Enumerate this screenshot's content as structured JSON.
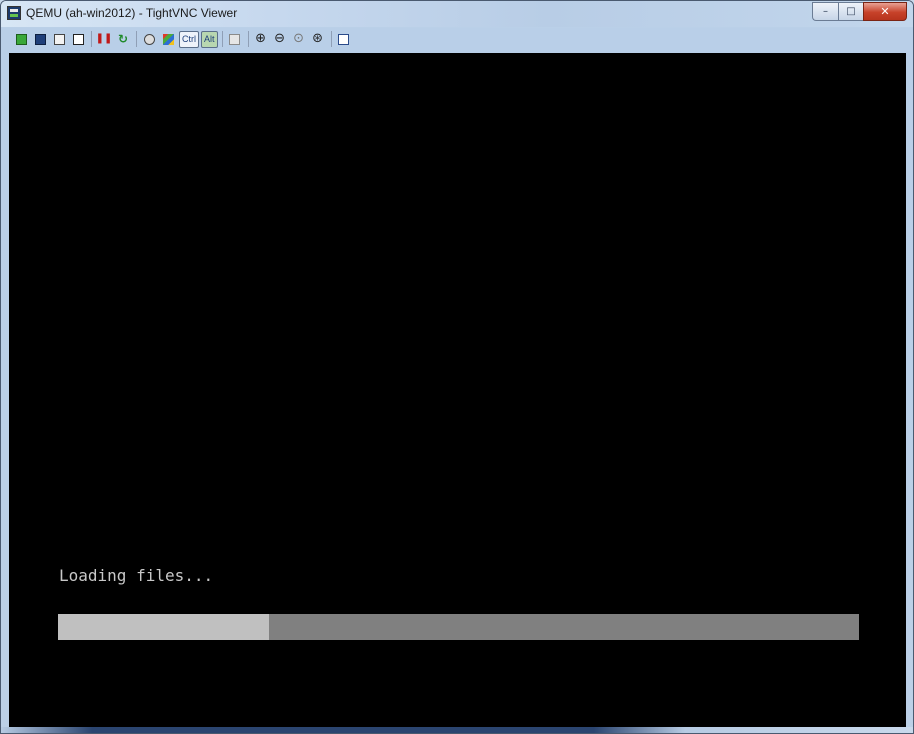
{
  "window": {
    "title": "QEMU (ah-win2012) - TightVNC Viewer",
    "controls": {
      "minimize": "–",
      "maximize": "□",
      "close": "✕"
    }
  },
  "toolbar": {
    "items": [
      {
        "name": "new-connection-icon",
        "glyph": ""
      },
      {
        "name": "save-icon",
        "glyph": ""
      },
      {
        "name": "options-icon",
        "glyph": ""
      },
      {
        "name": "connection-info-icon",
        "glyph": ""
      },
      {
        "name": "pause-icon",
        "glyph": "❚❚"
      },
      {
        "name": "refresh-icon",
        "glyph": "↻"
      },
      {
        "name": "ctrl-alt-del-icon",
        "glyph": ""
      },
      {
        "name": "win-key-icon",
        "glyph": ""
      },
      {
        "name": "transfer-files-icon",
        "glyph": ""
      },
      {
        "name": "zoom-in-icon",
        "glyph": "🔎"
      },
      {
        "name": "zoom-out-icon",
        "glyph": "🔍"
      },
      {
        "name": "zoom-100-icon",
        "glyph": "🔍"
      },
      {
        "name": "zoom-auto-icon",
        "glyph": "🔍"
      },
      {
        "name": "fullscreen-icon",
        "glyph": ""
      }
    ],
    "ctrl_label": "Ctrl",
    "alt_label": "Alt"
  },
  "remote_screen": {
    "status_text": "Loading files...",
    "progress_fraction": 0.263,
    "colors": {
      "background": "#000000",
      "text": "#c8c8c8",
      "track": "#808080",
      "fill": "#c0c0c0"
    }
  }
}
